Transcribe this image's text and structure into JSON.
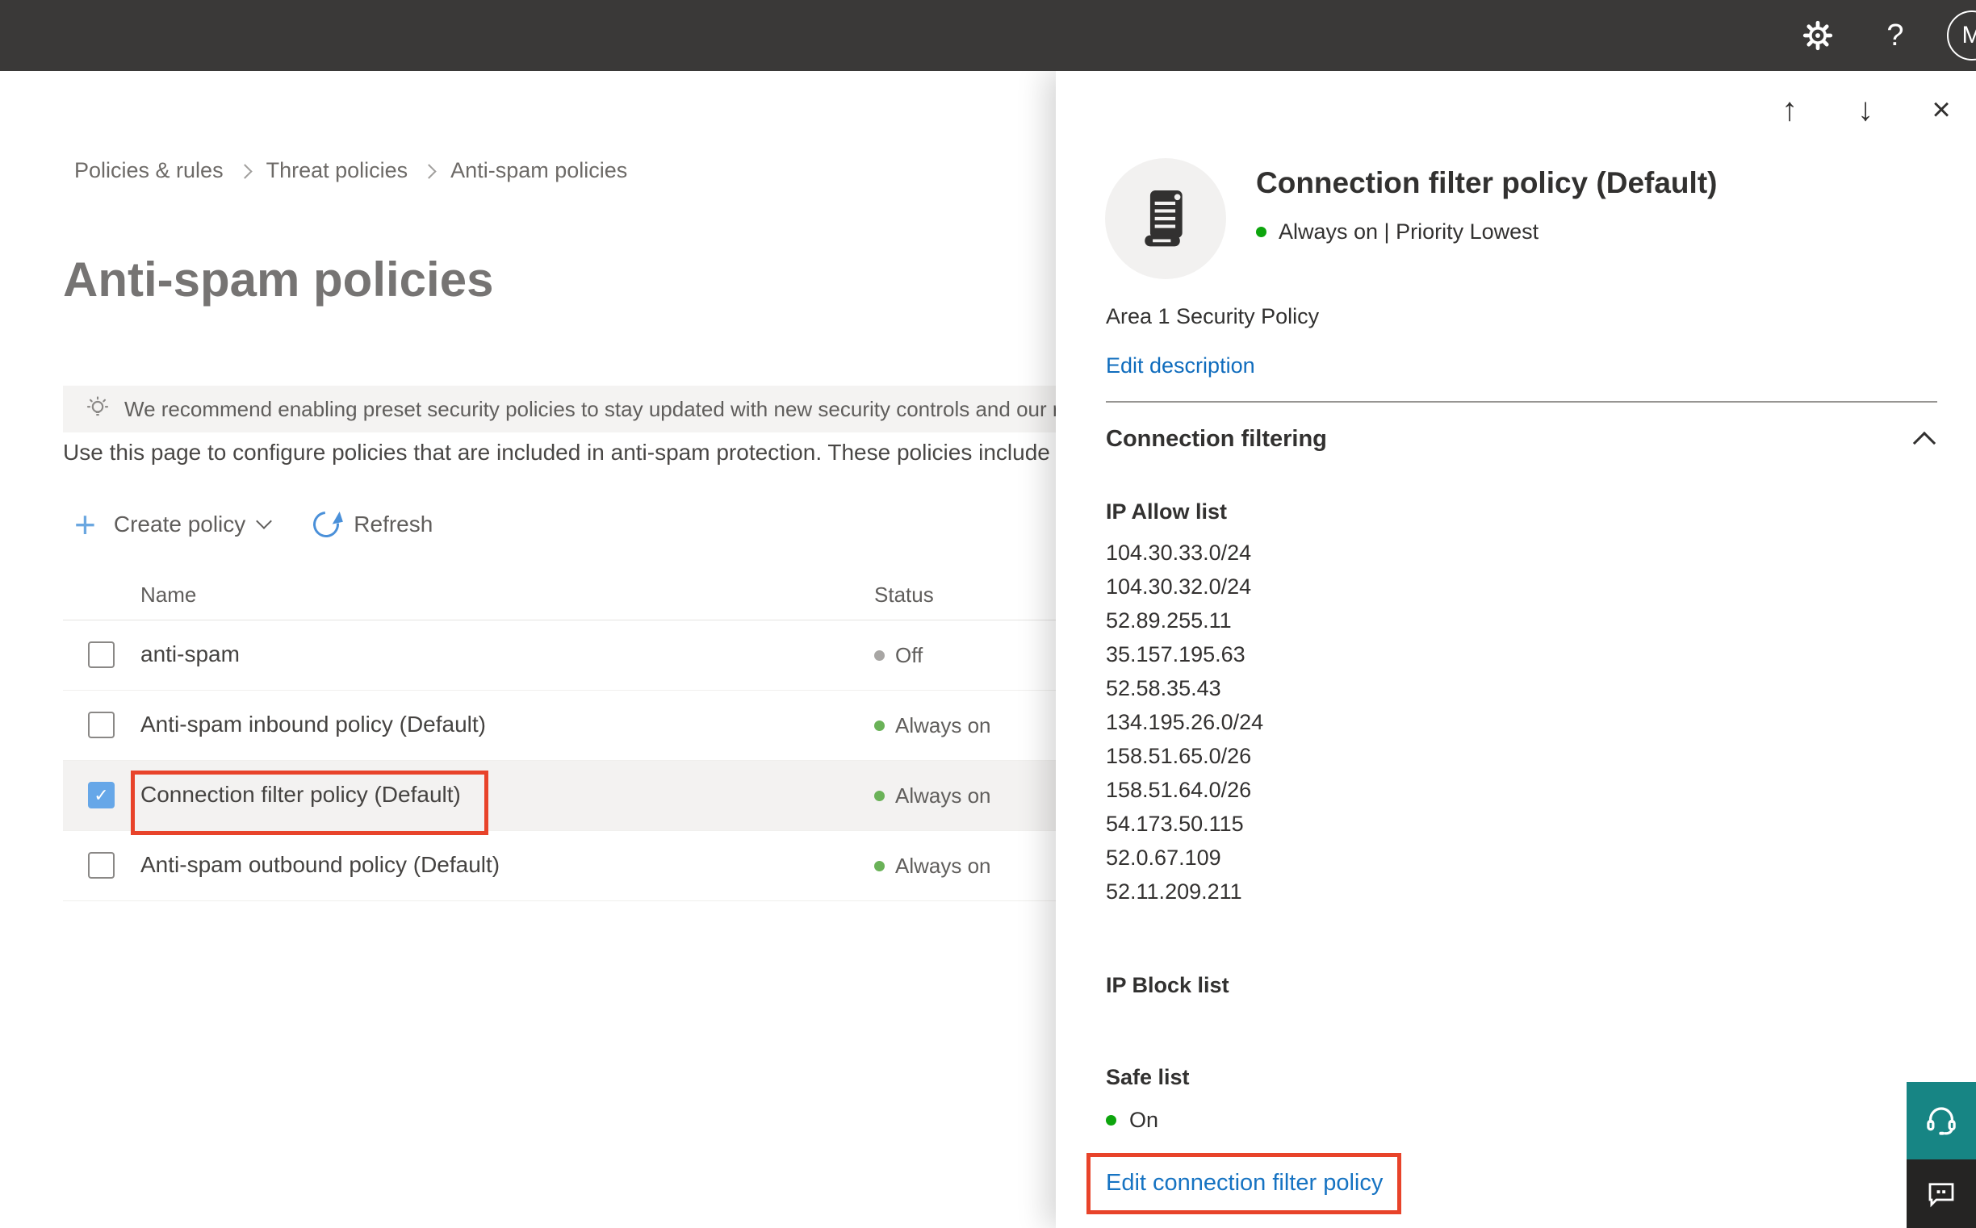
{
  "topbar": {
    "avatar_initial": "M",
    "help_glyph": "?"
  },
  "breadcrumb": {
    "items": [
      "Policies & rules",
      "Threat policies",
      "Anti-spam policies"
    ]
  },
  "page": {
    "title": "Anti-spam policies",
    "banner": "We recommend enabling preset security policies to stay updated with new security controls and our recomme",
    "description": "Use this page to configure policies that are included in anti-spam protection. These policies include"
  },
  "toolbar": {
    "plus_glyph": "+",
    "create_label": "Create policy",
    "refresh_label": "Refresh"
  },
  "table": {
    "columns": [
      "Name",
      "Status"
    ],
    "rows": [
      {
        "name": "anti-spam",
        "status": "Off"
      },
      {
        "name": "Anti-spam inbound policy (Default)",
        "status": "Always on"
      },
      {
        "name": "Connection filter policy (Default)",
        "status": "Always on"
      },
      {
        "name": "Anti-spam outbound policy (Default)",
        "status": "Always on"
      }
    ]
  },
  "flyout": {
    "nav": {
      "up_glyph": "↑",
      "down_glyph": "↓",
      "close_glyph": "×"
    },
    "title": "Connection filter policy (Default)",
    "status": "Always on | Priority Lowest",
    "policy_description": "Area 1 Security Policy",
    "edit_description_label": "Edit description",
    "section_title": "Connection filtering",
    "ip_allow_label": "IP Allow list",
    "ip_allow": [
      "104.30.33.0/24",
      "104.30.32.0/24",
      "52.89.255.11",
      "35.157.195.63",
      "52.58.35.43",
      "134.195.26.0/24",
      "158.51.65.0/26",
      "158.51.64.0/26",
      "54.173.50.115",
      "52.0.67.109",
      "52.11.209.211"
    ],
    "ip_block_label": "IP Block list",
    "safe_list_label": "Safe list",
    "safe_list_status": "On",
    "edit_link_label": "Edit connection filter policy"
  },
  "colors": {
    "topbar_bg": "#3a3938",
    "accent_blue": "#0f6cbd",
    "link_blue": "#1673c2",
    "checkbox_blue": "#66a7e8",
    "status_green": "#6ab258",
    "status_green_bright": "#0da50d",
    "status_gray": "#a8a6a4",
    "annotation_red": "#e8432a",
    "teal_button": "#178584",
    "dark_button": "#252423",
    "selected_row_bg": "#f3f2f1"
  }
}
